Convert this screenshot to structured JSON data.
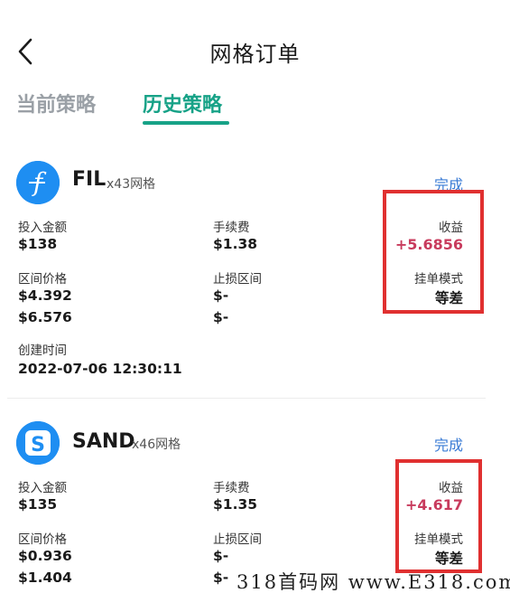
{
  "header": {
    "title": "网格订单"
  },
  "tabs": {
    "current": "当前策略",
    "history": "历史策略"
  },
  "cards": [
    {
      "coin": "FIL",
      "grid": "x43网格",
      "icon": "filecoin-icon",
      "status": "完成",
      "invest_label": "投入金额",
      "invest_value": "$138",
      "fee_label": "手续费",
      "fee_value": "$1.38",
      "profit_label": "收益",
      "profit_value": "+5.6856",
      "range_label": "区间价格",
      "range_low": "$4.392",
      "range_high": "$6.576",
      "stop_label": "止损区间",
      "stop_low": "$-",
      "stop_high": "$-",
      "mode_label": "挂单模式",
      "mode_value": "等差",
      "created_label": "创建时间",
      "created_value": "2022-07-06 12:30:11"
    },
    {
      "coin": "SAND",
      "grid": "x46网格",
      "icon": "sandbox-icon",
      "status": "完成",
      "invest_label": "投入金额",
      "invest_value": "$135",
      "fee_label": "手续费",
      "fee_value": "$1.35",
      "profit_label": "收益",
      "profit_value": "+4.617",
      "range_label": "区间价格",
      "range_low": "$0.936",
      "range_high": "$1.404",
      "stop_label": "止损区间",
      "stop_low": "$-",
      "stop_high": "$-",
      "mode_label": "挂单模式",
      "mode_value": "等差"
    }
  ],
  "colors": {
    "accent": "#17a287",
    "profit": "#c83b5d",
    "status": "#3a7bd5",
    "highlight": "#e03030",
    "coin_icon": "#1e8ef2"
  },
  "watermark": "318首码网 www.E318.com"
}
